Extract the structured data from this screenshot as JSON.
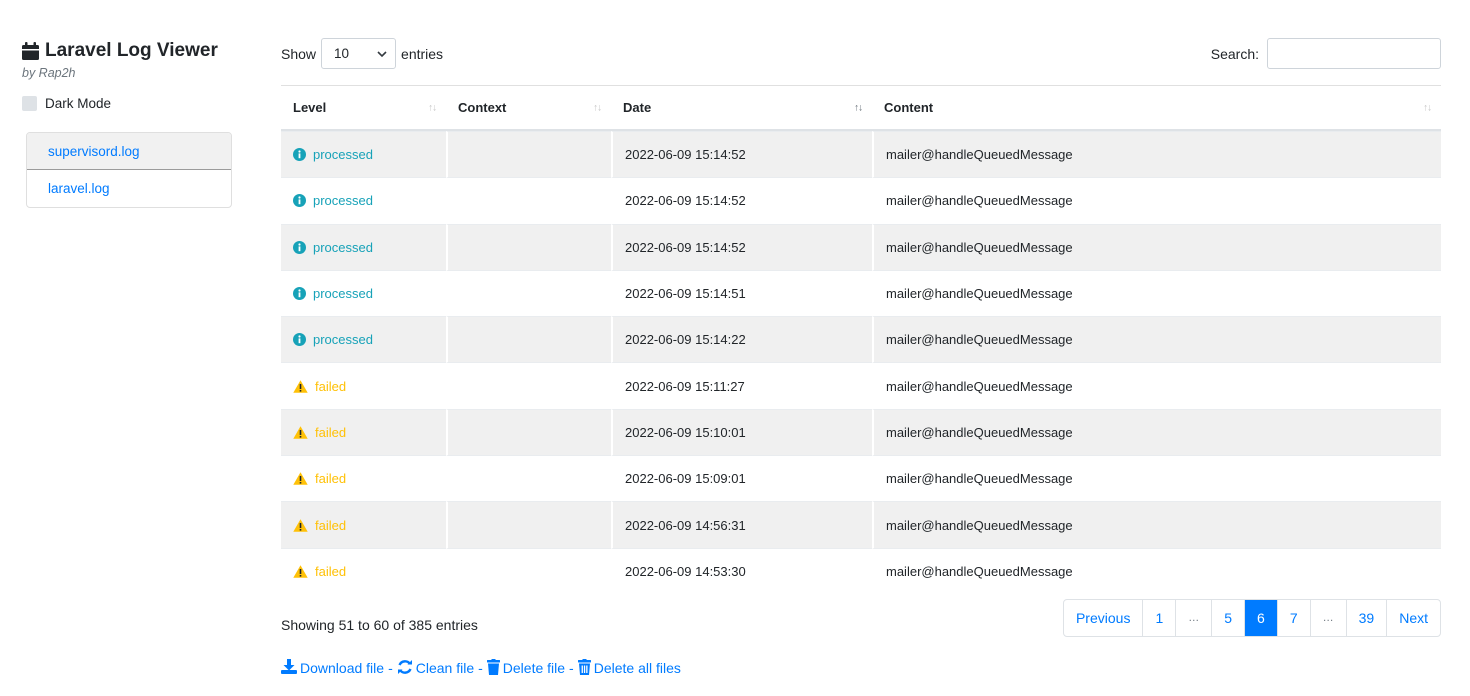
{
  "sidebar": {
    "title": "Laravel Log Viewer",
    "byline": "by Rap2h",
    "dark_mode_label": "Dark Mode",
    "files": [
      "supervisord.log",
      "laravel.log"
    ]
  },
  "controls": {
    "show_label": "Show",
    "page_length": "10",
    "entries_label": "entries",
    "search_label": "Search:",
    "search_value": ""
  },
  "table": {
    "headers": {
      "level": "Level",
      "context": "Context",
      "date": "Date",
      "content": "Content"
    },
    "rows": [
      {
        "level": "processed",
        "type": "info",
        "context": "",
        "date": "2022-06-09 15:14:52",
        "content": "mailer@handleQueuedMessage"
      },
      {
        "level": "processed",
        "type": "info",
        "context": "",
        "date": "2022-06-09 15:14:52",
        "content": "mailer@handleQueuedMessage"
      },
      {
        "level": "processed",
        "type": "info",
        "context": "",
        "date": "2022-06-09 15:14:52",
        "content": "mailer@handleQueuedMessage"
      },
      {
        "level": "processed",
        "type": "info",
        "context": "",
        "date": "2022-06-09 15:14:51",
        "content": "mailer@handleQueuedMessage"
      },
      {
        "level": "processed",
        "type": "info",
        "context": "",
        "date": "2022-06-09 15:14:22",
        "content": "mailer@handleQueuedMessage"
      },
      {
        "level": "failed",
        "type": "warning",
        "context": "",
        "date": "2022-06-09 15:11:27",
        "content": "mailer@handleQueuedMessage"
      },
      {
        "level": "failed",
        "type": "warning",
        "context": "",
        "date": "2022-06-09 15:10:01",
        "content": "mailer@handleQueuedMessage"
      },
      {
        "level": "failed",
        "type": "warning",
        "context": "",
        "date": "2022-06-09 15:09:01",
        "content": "mailer@handleQueuedMessage"
      },
      {
        "level": "failed",
        "type": "warning",
        "context": "",
        "date": "2022-06-09 14:56:31",
        "content": "mailer@handleQueuedMessage"
      },
      {
        "level": "failed",
        "type": "warning",
        "context": "",
        "date": "2022-06-09 14:53:30",
        "content": "mailer@handleQueuedMessage"
      }
    ]
  },
  "footer": {
    "info": "Showing 51 to 60 of 385 entries",
    "pages": [
      "Previous",
      "1",
      "…",
      "5",
      "6",
      "7",
      "…",
      "39",
      "Next"
    ]
  },
  "actions": {
    "download": "Download file",
    "clean": "Clean file",
    "delete": "Delete file",
    "delete_all": "Delete all files",
    "separator": "-"
  },
  "colors": {
    "link": "#007bff",
    "info": "#17a2b8",
    "warning": "#ffc107"
  },
  "icons": {
    "title": "calendar-icon",
    "info": "info-circle-icon",
    "warning": "warning-triangle-icon",
    "download": "download-icon",
    "clean": "sync-icon",
    "delete": "trash-icon",
    "delete_all": "trash-alt-icon"
  }
}
